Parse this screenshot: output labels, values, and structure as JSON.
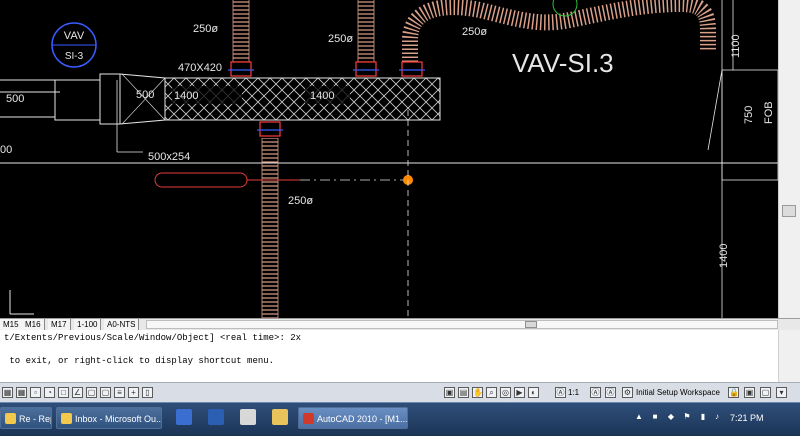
{
  "drawing": {
    "bubble_top": "VAV",
    "bubble_bottom": "SI-3",
    "dim_470x420": "470X420",
    "dim_500_left": "500",
    "dim_500_inner": "500",
    "dim_1400_a": "1400",
    "dim_1400_b": "1400",
    "dim_500x254": "500x254",
    "dia_250_a": "250ø",
    "dia_250_b": "250ø",
    "dia_250_c": "250ø",
    "dia_250_d": "250ø",
    "vav_label": "VAV-SI.3",
    "dim_1100": "1100",
    "dim_750": "750",
    "fob": "FOB",
    "dim_1400_v": "1400",
    "cut_left": "00",
    "colors": {
      "background": "#000000",
      "duct": "#e6e6e6",
      "flex": "#d9a08a",
      "grip": "#ff8a00",
      "red": "#e33b3b",
      "blue": "#3a5bff"
    }
  },
  "layout_tabs": [
    "M15",
    "M16",
    "M17",
    "1-100",
    "A0-NTS"
  ],
  "command": {
    "line1": "t/Extents/Previous/Scale/Window/Object] <real time>: 2x",
    "line2": " to exit, or right-click to display shortcut menu."
  },
  "status": {
    "scale": "1:1",
    "workspace": "Initial Setup Workspace"
  },
  "taskbar": {
    "items": [
      "Re - Reply t...",
      "Inbox - Microsoft Ou...",
      "AutoCAD 2010 - [M1..."
    ],
    "clock": "7:21 PM"
  }
}
